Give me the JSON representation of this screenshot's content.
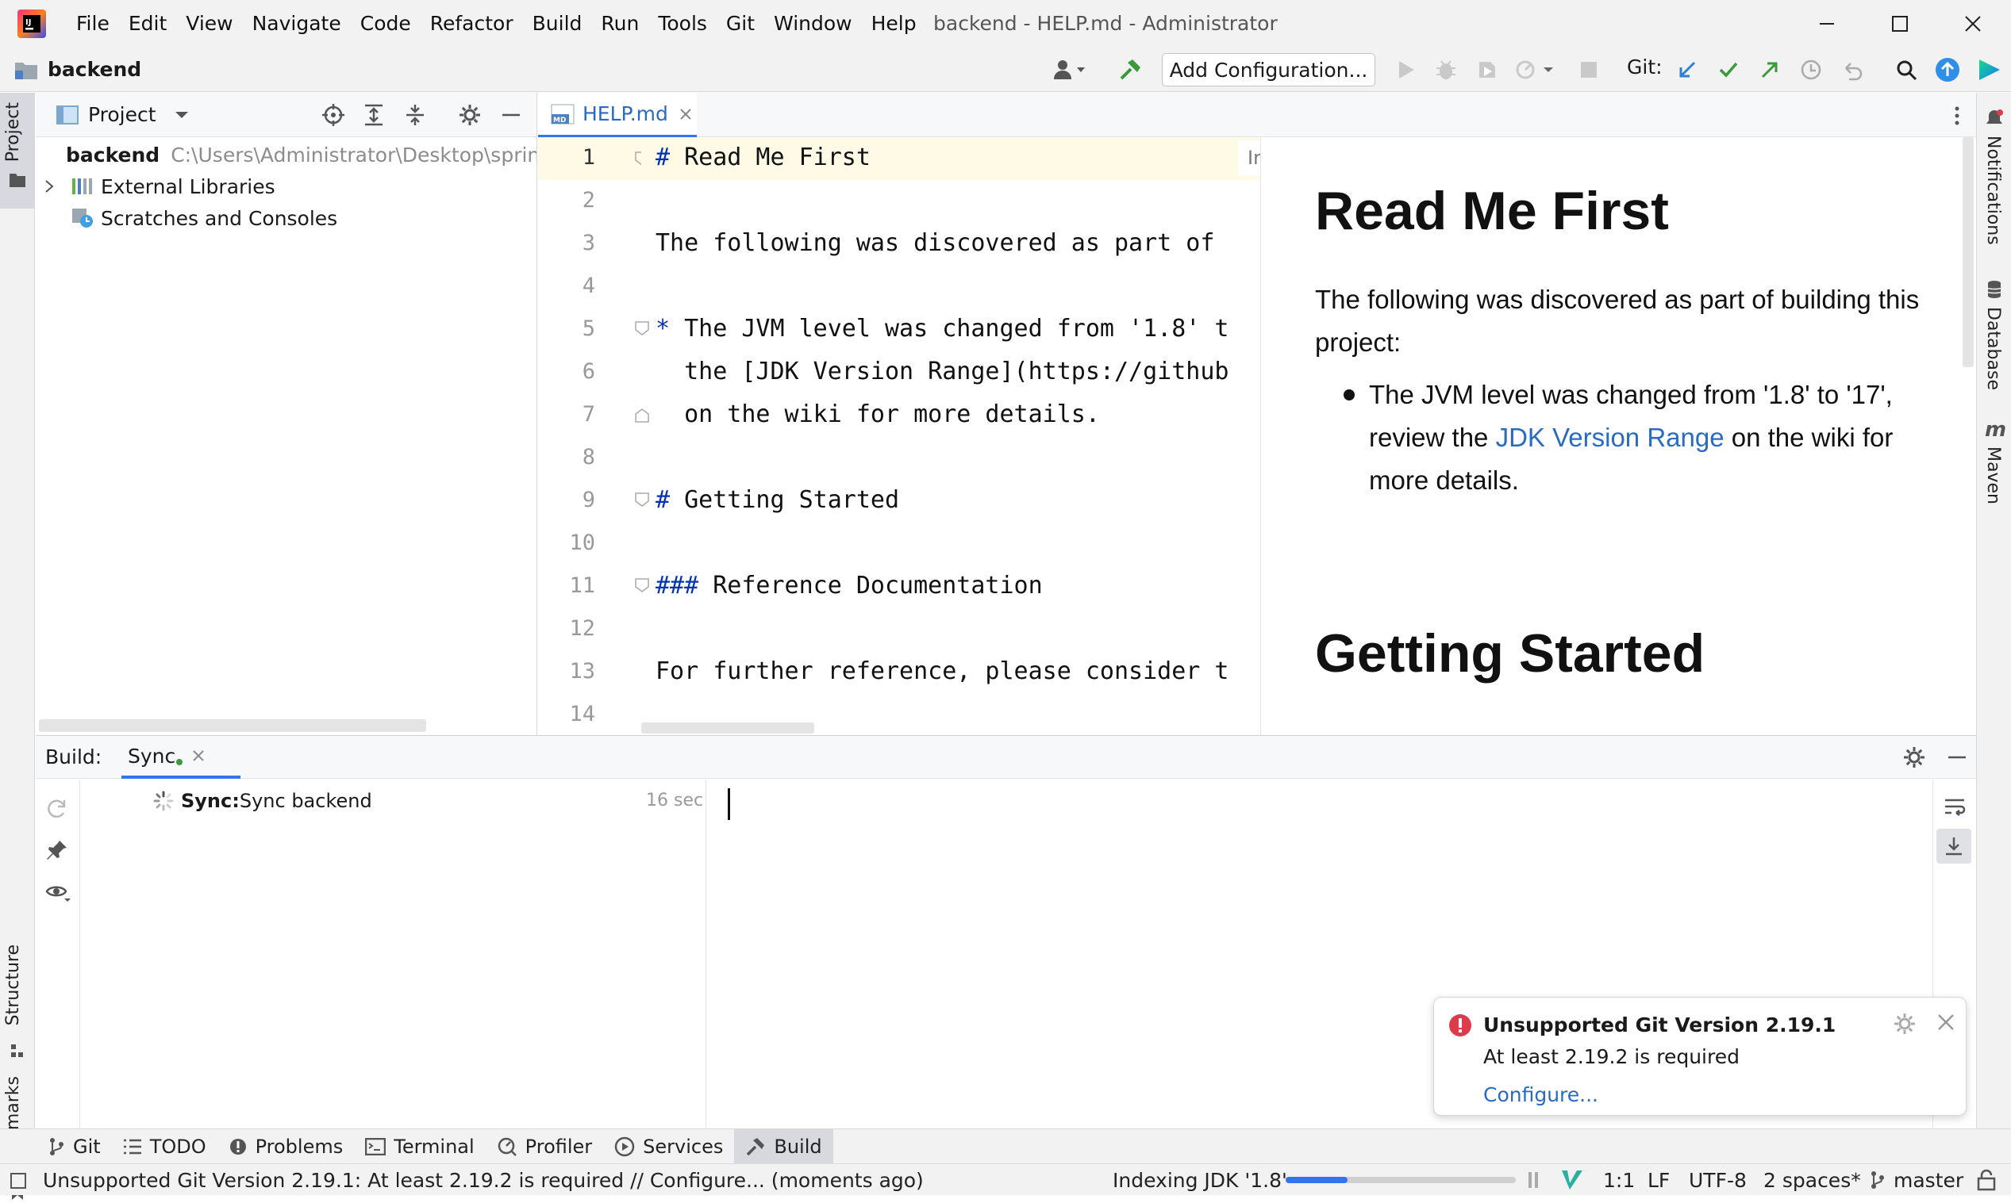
{
  "window": {
    "title": "backend - HELP.md - Administrator",
    "menu": [
      "File",
      "Edit",
      "View",
      "Navigate",
      "Code",
      "Refactor",
      "Build",
      "Run",
      "Tools",
      "Git",
      "Window",
      "Help"
    ]
  },
  "navbar": {
    "project": "backend",
    "add_config": "Add Configuration...",
    "git_label": "Git:"
  },
  "project_panel": {
    "title": "Project",
    "tree": [
      {
        "label": "backend",
        "path": "C:\\Users\\Administrator\\Desktop\\spring"
      },
      {
        "label": "External Libraries"
      },
      {
        "label": "Scratches and Consoles"
      }
    ]
  },
  "editor": {
    "tab": "HELP.md",
    "indexing": "Indexing...",
    "lines": [
      "1",
      "2",
      "3",
      "4",
      "5",
      "6",
      "7",
      "8",
      "9",
      "10",
      "11",
      "12",
      "13",
      "14"
    ],
    "code": {
      "l1_hash": "#",
      "l1_text": " Read Me First",
      "l3": "The following was discovered as part of",
      "l5_star": "*",
      "l5_text": " The JVM level was changed from '1.8' t",
      "l6": "  the [JDK Version Range](https://github",
      "l7": "  on the wiki for more details.",
      "l9_hash": "#",
      "l9_text": " Getting Started",
      "l11_hash": "###",
      "l11_text": " Reference Documentation",
      "l13": "For further reference, please consider t"
    }
  },
  "preview": {
    "h1": "Read Me First",
    "p1": "The following was discovered as part of building this project:",
    "li_a": "The JVM level was changed from '1.8' to '17', review the ",
    "li_link": "JDK Version Range",
    "li_b": " on the wiki for more details.",
    "h2": "Getting Started"
  },
  "build": {
    "label": "Build:",
    "tab": "Sync",
    "sync_bold": "Sync:",
    "sync_text": " Sync backend",
    "time": "16 sec"
  },
  "notification": {
    "title": "Unsupported Git Version 2.19.1",
    "body": "At least 2.19.2 is required",
    "action": "Configure..."
  },
  "tool_windows": [
    "Git",
    "TODO",
    "Problems",
    "Terminal",
    "Profiler",
    "Services",
    "Build"
  ],
  "side_tabs": {
    "left_top": "Project",
    "left_mid": "Structure",
    "left_bottom": "Bookmarks",
    "right": [
      "Notifications",
      "Database",
      "Maven"
    ]
  },
  "status": {
    "message": "Unsupported Git Version 2.19.1: At least 2.19.2 is required // Configure... (moments ago)",
    "indexing": "Indexing JDK '1.8'",
    "indexing_progress": 0.27,
    "position": "1:1",
    "line_sep": "LF",
    "encoding": "UTF-8",
    "indent": "2 spaces*",
    "branch": "master"
  },
  "colors": {
    "accent": "#3574f0",
    "link": "#2a6bc2",
    "error": "#db3b4b",
    "green": "#3a9a3a",
    "md_keyword": "#0033b3"
  }
}
